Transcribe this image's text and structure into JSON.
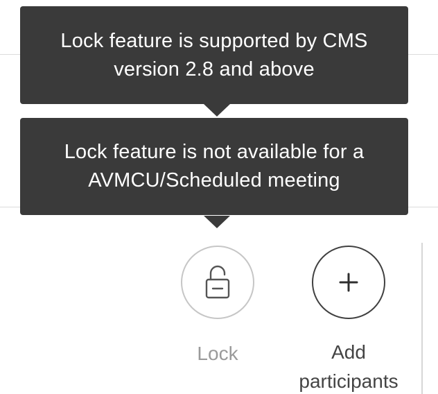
{
  "tooltips": {
    "first": "Lock feature is supported by CMS version 2.8 and above",
    "second": "Lock feature is not available for a AVMCU/Scheduled meeting"
  },
  "actions": {
    "lock": {
      "label": "Lock",
      "icon": "unlock-icon",
      "state": "disabled"
    },
    "add_participants": {
      "label": "Add participants",
      "icon": "plus-icon"
    }
  },
  "colors": {
    "tooltip_bg": "#3a3a3a",
    "tooltip_text": "#ffffff",
    "disabled_text": "#9a9a9a",
    "enabled_text": "#444444"
  }
}
